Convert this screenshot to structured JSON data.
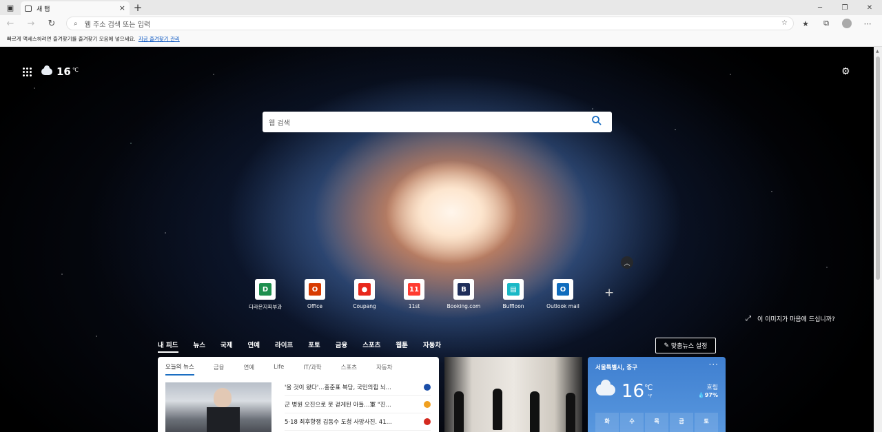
{
  "browser": {
    "tab_title": "새 탭",
    "new_tab_label": "+",
    "address_placeholder": "웹 주소 검색 또는 입력",
    "favbar_text": "빠르게 액세스하려면 즐겨찾기를 즐겨찾기 모음에 넣으세요.",
    "favbar_link": "지금 즐겨찾기 관리"
  },
  "ntp": {
    "temperature": "16",
    "temp_unit": "℃",
    "search_placeholder": "웹 검색",
    "like_image": "이 이미지가 마음에 드십니까?",
    "quick_links": [
      {
        "label": "디라온지피부과",
        "glyph": "D",
        "color": "#1e8f4e"
      },
      {
        "label": "Office",
        "glyph": "O",
        "color": "#d83b01"
      },
      {
        "label": "Coupang",
        "glyph": "●",
        "color": "#e8281c"
      },
      {
        "label": "11st",
        "glyph": "11",
        "color": "#ff3b30"
      },
      {
        "label": "Booking.com",
        "glyph": "B",
        "color": "#1f2e5a"
      },
      {
        "label": "Buffloon",
        "glyph": "▤",
        "color": "#19b8c6"
      },
      {
        "label": "Outlook mail",
        "glyph": "O",
        "color": "#0f6cbd"
      }
    ],
    "news_nav": [
      "내 피드",
      "뉴스",
      "국제",
      "연예",
      "라이프",
      "포토",
      "금융",
      "스포츠",
      "웹툰",
      "자동차"
    ],
    "personalize": "맞춤뉴스 설정",
    "news_tabs": [
      "오늘의 뉴스",
      "금융",
      "연예",
      "Life",
      "IT/과학",
      "스포츠",
      "자동차"
    ],
    "headlines": [
      {
        "text": "'올 것이 왔다'…홍준표 복당, 국민의힘 뇌...",
        "color": "#1b4ea8"
      },
      {
        "text": "군 병원 오진으로 못 걷게된 아들…軍 \"진...",
        "color": "#f0a020"
      },
      {
        "text": "5·18 최후항쟁 김동수 도청 사망사진. 41...",
        "color": "#d42a20"
      }
    ],
    "weather": {
      "location": "서울특별시, 중구",
      "temp": "16",
      "unit_c": "℃",
      "unit_f": "°F",
      "condition": "흐림",
      "humidity": "97%",
      "days": [
        "화",
        "수",
        "목",
        "금",
        "토"
      ]
    }
  }
}
